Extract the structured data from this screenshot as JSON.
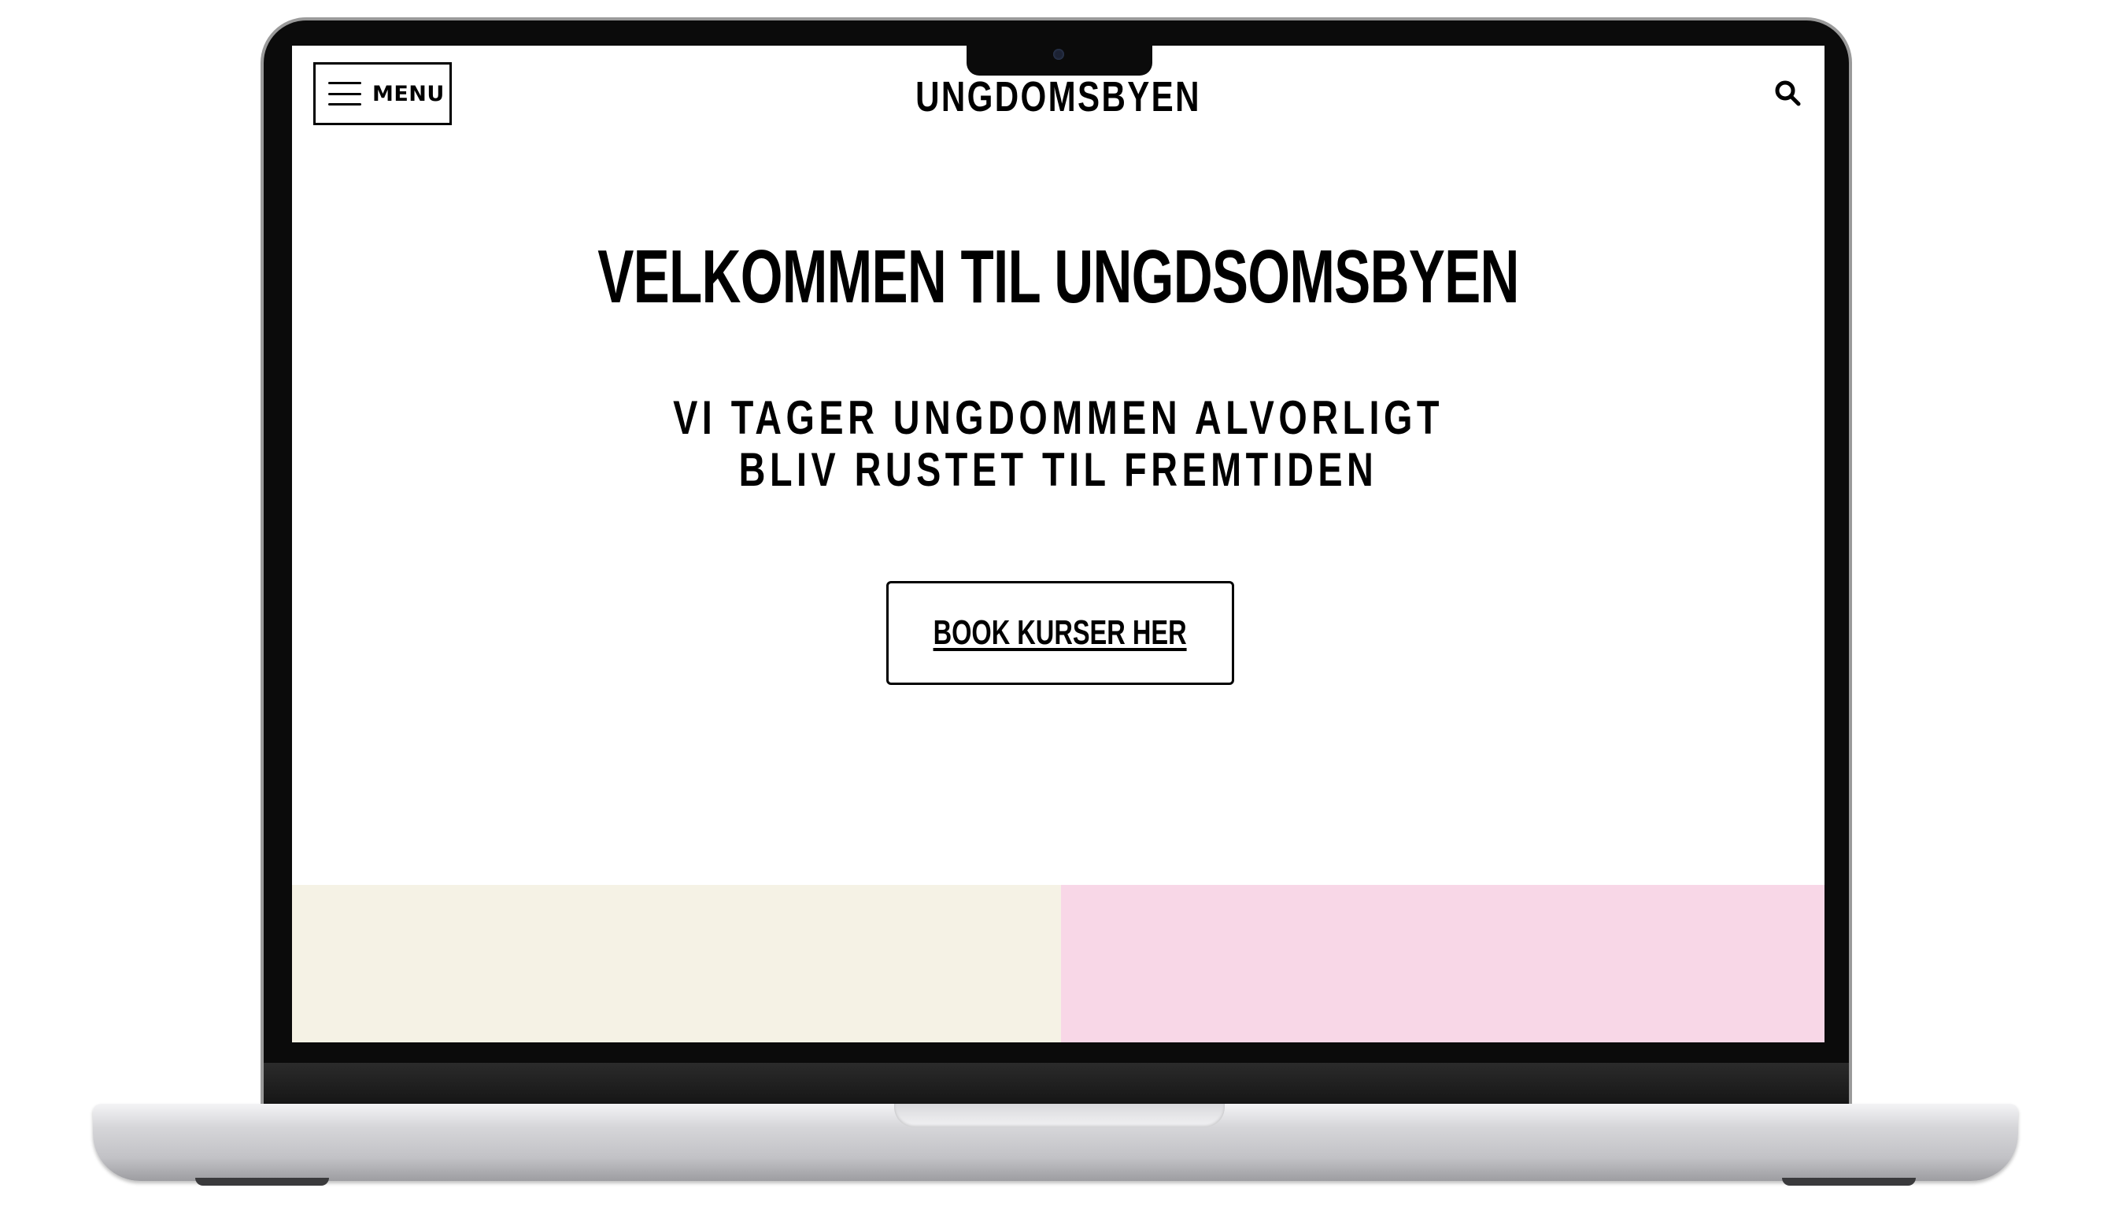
{
  "header": {
    "menu_label": "MENU",
    "logo": "UNGDOMSBYEN"
  },
  "hero": {
    "title": "VELKOMMEN TIL UNGDSOMSBYEN",
    "subtitle_line1": "VI TAGER UNGDOMMEN ALVORLIGT",
    "subtitle_line2": "BLIV RUSTET TIL FREMTIDEN",
    "cta_label": "BOOK KURSER HER"
  },
  "icons": {
    "menu": "hamburger-icon",
    "search": "search-icon"
  },
  "colors": {
    "panel_left": "#f5f2e5",
    "panel_right": "#f8d7e7",
    "text": "#000000"
  }
}
